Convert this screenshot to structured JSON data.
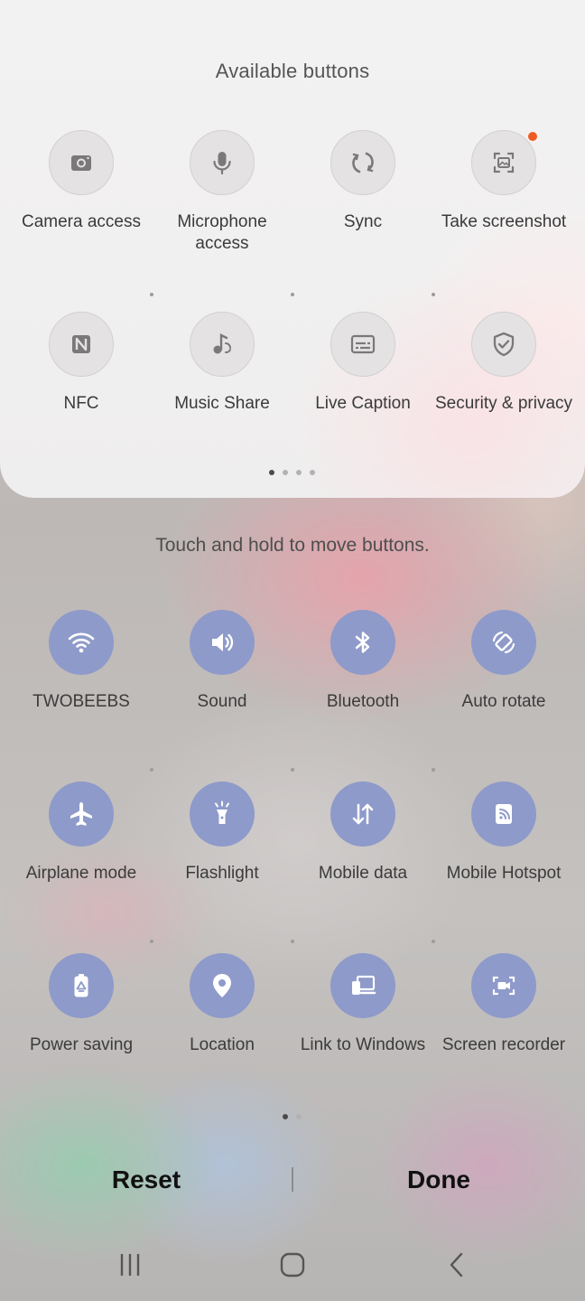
{
  "available": {
    "title": "Available buttons",
    "tiles": [
      {
        "label": "Camera access",
        "icon": "camera-icon"
      },
      {
        "label": "Microphone access",
        "icon": "microphone-icon"
      },
      {
        "label": "Sync",
        "icon": "sync-icon"
      },
      {
        "label": "Take screenshot",
        "icon": "screenshot-icon",
        "badge": true
      },
      {
        "label": "NFC",
        "icon": "nfc-icon"
      },
      {
        "label": "Music Share",
        "icon": "music-share-icon"
      },
      {
        "label": "Live Caption",
        "icon": "live-caption-icon"
      },
      {
        "label": "Security & privacy",
        "icon": "shield-check-icon"
      }
    ],
    "pages": 4,
    "current_page": 1
  },
  "hint": "Touch and hold to move buttons.",
  "active": {
    "tiles": [
      {
        "label": "TWOBEEBS",
        "icon": "wifi-icon"
      },
      {
        "label": "Sound",
        "icon": "speaker-icon"
      },
      {
        "label": "Bluetooth",
        "icon": "bluetooth-icon"
      },
      {
        "label": "Auto rotate",
        "icon": "auto-rotate-icon"
      },
      {
        "label": "Airplane mode",
        "icon": "airplane-icon"
      },
      {
        "label": "Flashlight",
        "icon": "flashlight-icon"
      },
      {
        "label": "Mobile data",
        "icon": "mobile-data-icon"
      },
      {
        "label": "Mobile Hotspot",
        "icon": "hotspot-icon"
      },
      {
        "label": "Power saving",
        "icon": "power-saving-icon"
      },
      {
        "label": "Location",
        "icon": "location-icon"
      },
      {
        "label": "Link to Windows",
        "icon": "link-to-windows-icon"
      },
      {
        "label": "Screen recorder",
        "icon": "screen-recorder-icon"
      }
    ],
    "pages": 2,
    "current_page": 1
  },
  "actions": {
    "reset_label": "Reset",
    "done_label": "Done"
  },
  "navbar": {
    "recents": "recents-icon",
    "home": "home-icon",
    "back": "back-icon"
  },
  "colors": {
    "active_tile": "#8e9ac9",
    "inactive_tile": "#e4e2e2",
    "badge": "#f05a22"
  }
}
